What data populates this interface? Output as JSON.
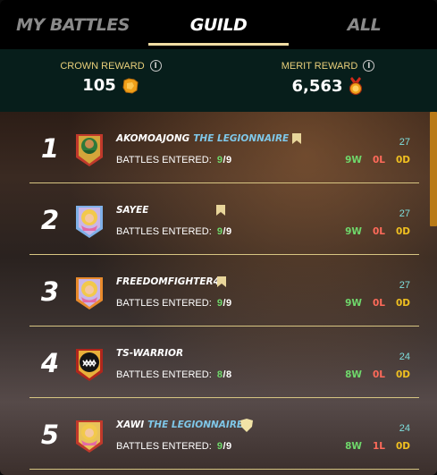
{
  "tabs": [
    {
      "label": "MY BATTLES",
      "active": false
    },
    {
      "label": "GUILD",
      "active": true
    },
    {
      "label": "ALL",
      "active": false
    }
  ],
  "rewards": {
    "crown": {
      "label": "CROWN REWARD",
      "value": "105",
      "icon": "crown-token-icon"
    },
    "merit": {
      "label": "MERIT REWARD",
      "value": "6,563",
      "icon": "merit-medal-icon"
    }
  },
  "leaderboard": [
    {
      "rank": "1",
      "name": "AKOMOAJONG",
      "title": "THE LEGIONNAIRE",
      "badge": "bookmark-icon",
      "battles_label": "BATTLES ENTERED:",
      "battles_done": "9",
      "battles_total": "/9",
      "score": "27",
      "wins": "9W",
      "losses": "0L",
      "draws": "0D",
      "avatar": "green-warrior-avatar"
    },
    {
      "rank": "2",
      "name": "SAYEE",
      "title": "",
      "badge": "bookmark-icon",
      "battles_label": "BATTLES ENTERED:",
      "battles_done": "9",
      "battles_total": "/9",
      "score": "27",
      "wins": "9W",
      "losses": "0L",
      "draws": "0D",
      "avatar": "blonde-mage-avatar"
    },
    {
      "rank": "3",
      "name": "FREEDOMFIGHTER4",
      "title": "",
      "badge": "bookmark-icon",
      "battles_label": "BATTLES ENTERED:",
      "battles_done": "9",
      "battles_total": "/9",
      "score": "27",
      "wins": "9W",
      "losses": "0L",
      "draws": "0D",
      "avatar": "blonde-mage-avatar"
    },
    {
      "rank": "4",
      "name": "TS-WARRIOR",
      "title": "",
      "badge": "",
      "battles_label": "BATTLES ENTERED:",
      "battles_done": "8",
      "battles_total": "/8",
      "score": "24",
      "wins": "8W",
      "losses": "0L",
      "draws": "0D",
      "avatar": "dark-beast-avatar"
    },
    {
      "rank": "5",
      "name": "XAWI",
      "title": "THE LEGIONNAIRE",
      "badge": "shield-icon",
      "battles_label": "BATTLES ENTERED:",
      "battles_done": "9",
      "battles_total": "/9",
      "score": "24",
      "wins": "8W",
      "losses": "1L",
      "draws": "0D",
      "avatar": "blonde-mage-avatar"
    }
  ],
  "colors": {
    "accent_gold": "#e8cf7a",
    "win": "#6fd86b",
    "loss": "#ff6a5a",
    "draw": "#f0c020",
    "score": "#7fe0df",
    "title": "#7fc7e8"
  }
}
